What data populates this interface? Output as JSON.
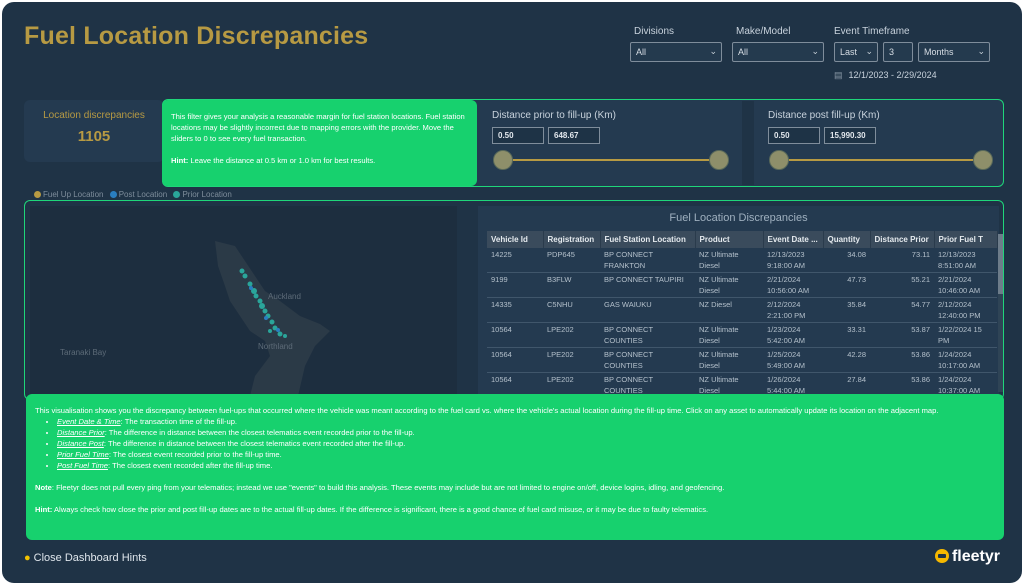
{
  "header": {
    "title": "Fuel Location Discrepancies"
  },
  "filters": {
    "divisions": {
      "label": "Divisions",
      "value": "All"
    },
    "make_model": {
      "label": "Make/Model",
      "value": "All"
    },
    "event_timeframe": {
      "label": "Event Timeframe",
      "period": "Last",
      "count": "3",
      "unit": "Months"
    },
    "date_range": "12/1/2023 - 2/29/2024"
  },
  "kpi": {
    "label": "Location discrepancies",
    "value": "1105"
  },
  "hint_top": {
    "text": "This filter gives your analysis a reasonable margin for fuel station locations. Fuel station locations may be slightly incorrect due to mapping errors with the provider. Move the sliders to 0 to see every fuel transaction.",
    "hint_label": "Hint:",
    "hint_text": " Leave the distance at 0.5 km or 1.0 km for best results."
  },
  "slider_prior": {
    "label": "Distance prior to fill-up (Km)",
    "min": "0.50",
    "max": "648.67",
    "min_frac": 0.0,
    "max_frac": 1.0
  },
  "slider_post": {
    "label": "Distance post fill-up (Km)",
    "min": "0.50",
    "max": "15,990.30",
    "min_frac": 0.0,
    "max_frac": 1.0
  },
  "legend": {
    "items": [
      "Fuel Up Location",
      "Post Location",
      "Prior Location"
    ],
    "colors": [
      "#b79a43",
      "#2a7fc1",
      "#2aa59a"
    ]
  },
  "map": {
    "labels": [
      "Auckland",
      "Northland",
      "Taranaki Bay"
    ]
  },
  "table": {
    "title": "Fuel Location Discrepancies",
    "columns": [
      "Vehicle Id",
      "Registration",
      "Fuel Station Location",
      "Product",
      "Event Date ...",
      "Quantity",
      "Distance Prior",
      "Prior Fuel T"
    ],
    "rows": [
      [
        "14225",
        "PDP645",
        "BP CONNECT\nFRANKTON",
        "NZ Ultimate\nDiesel",
        "12/13/2023\n9:18:00 AM",
        "34.08",
        "73.11",
        "12/13/2023\n8:51:00 AM"
      ],
      [
        "9199",
        "B3FLW",
        "BP CONNECT TAUPIRI",
        "NZ Ultimate\nDiesel",
        "2/21/2024\n10:56:00 AM",
        "47.73",
        "55.21",
        "2/21/2024\n10:46:00 AM"
      ],
      [
        "14335",
        "C5NHU",
        "GAS WAIUKU",
        "NZ Diesel",
        "2/12/2024\n2:21:00 PM",
        "35.84",
        "54.77",
        "2/12/2024\n12:40:00 PM"
      ],
      [
        "10564",
        "LPE202",
        "BP CONNECT\nCOUNTIES",
        "NZ Ultimate\nDiesel",
        "1/23/2024\n5:42:00 AM",
        "33.31",
        "53.87",
        "1/22/2024 15\nPM"
      ],
      [
        "10564",
        "LPE202",
        "BP CONNECT\nCOUNTIES",
        "NZ Ultimate\nDiesel",
        "1/25/2024\n5:49:00 AM",
        "42.28",
        "53.86",
        "1/24/2024\n10:17:00 AM"
      ],
      [
        "10564",
        "LPE202",
        "BP CONNECT\nCOUNTIES",
        "NZ Ultimate\nDiesel",
        "1/26/2024\n5:44:00 AM",
        "27.84",
        "53.86",
        "1/24/2024\n10:37:00 AM"
      ]
    ]
  },
  "hint_bottom": {
    "intro": "This visualisation shows you the discrepancy between fuel-ups that occurred where the vehicle was meant according to the fuel card vs. where the vehicle's actual location during the fill-up time. Click on any asset to automatically update its location on the adjacent map.",
    "bullets": [
      {
        "term": "Event Date & Time",
        "desc": ": The transaction time of the fill-up."
      },
      {
        "term": "Distance Prior",
        "desc": ": The difference in distance between the closest telematics event recorded prior to the fill-up."
      },
      {
        "term": "Distance Post",
        "desc": ": The difference in distance between the closest telematics event recorded after the fill-up."
      },
      {
        "term": "Prior Fuel Time",
        "desc": ": The closest event recorded prior to the fill-up time."
      },
      {
        "term": "Post Fuel Time",
        "desc": ": The closest event recorded after the fill-up time."
      }
    ],
    "note_label": "Note",
    "note_text": ": Fleetyr does not pull every ping from your telematics; instead we use \"events\" to build this analysis. These events may include but are not limited to engine on/off, device logins, idling, and geofencing.",
    "hint_label": "Hint:",
    "hint_text": " Always check how close the prior and post fill-up dates are to the actual fill-up dates. If the difference is significant, there is a good chance of fuel card misuse, or it may be due to faulty telematics."
  },
  "footer": {
    "close_hints": "Close Dashboard Hints",
    "brand": "fleetyr"
  },
  "icons": {
    "bulb": "lightbulb-icon",
    "calendar": "calendar-icon",
    "chevron": "chevron-down-icon",
    "logo": "fleetyr-logo-icon"
  }
}
